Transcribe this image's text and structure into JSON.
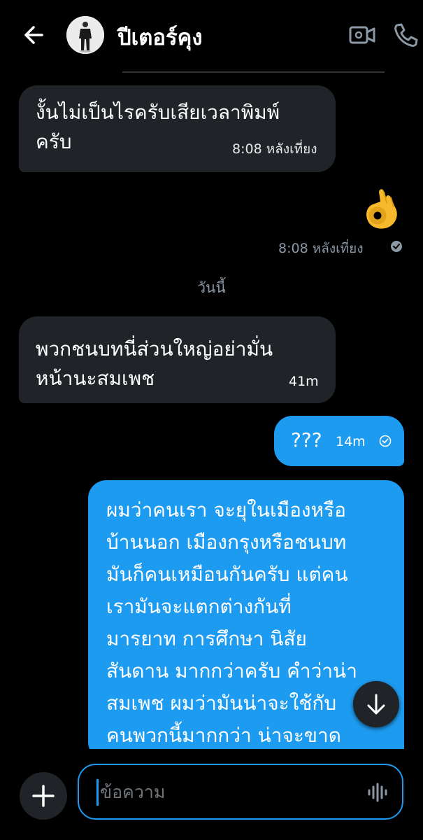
{
  "header": {
    "contact_name": "ปีเตอร์คุง",
    "icons": [
      "back-arrow-icon",
      "video-call-icon",
      "phone-icon"
    ]
  },
  "messages": [
    {
      "id": "m1",
      "direction": "incoming",
      "text": "งั้นไม่เป็นไรครับเสียเวลาพิมพ์\nครับ",
      "time": "8:08 หลังเที่ยง"
    },
    {
      "id": "m_emoji",
      "direction": "outgoing",
      "emoji": "👌",
      "time": "8:08 หลังเที่ยง",
      "status": "sent"
    }
  ],
  "day_separator": "วันนี้",
  "messages_today": [
    {
      "id": "m2",
      "direction": "incoming",
      "text": "พวกชนบทนี่ส่วนใหญ่อย่ามั่น\nหน้านะสมเพช",
      "time": "41m"
    },
    {
      "id": "m3",
      "direction": "outgoing",
      "text": "???",
      "time": "14m",
      "status": "sent"
    },
    {
      "id": "m4",
      "direction": "outgoing",
      "text": "ผมว่าคนเรา จะยุในเมืองหรือ\nบ้านนอก เมืองกรุงหรือชนบท\nมันก็คนเหมือนกันครับ แต่คน\nเรามันจะแตกต่างกันที่\nมารยาท การศึกษา นิสัย\nสันดาน มากกว่าครับ คำว่าน่า\nสมเพช ผมว่ามันน่าจะใช้กับ\nคนพวกนี้มากกว่า น่าจะขาด\nสามัญสำนึกที่"
    }
  ],
  "composer": {
    "placeholder": "ข้อความ"
  },
  "colors": {
    "background": "#000000",
    "incoming_bubble": "#202327",
    "outgoing_bubble": "#1d9bf0",
    "accent": "#1d9bf0",
    "secondary_text": "#8b98a5"
  }
}
